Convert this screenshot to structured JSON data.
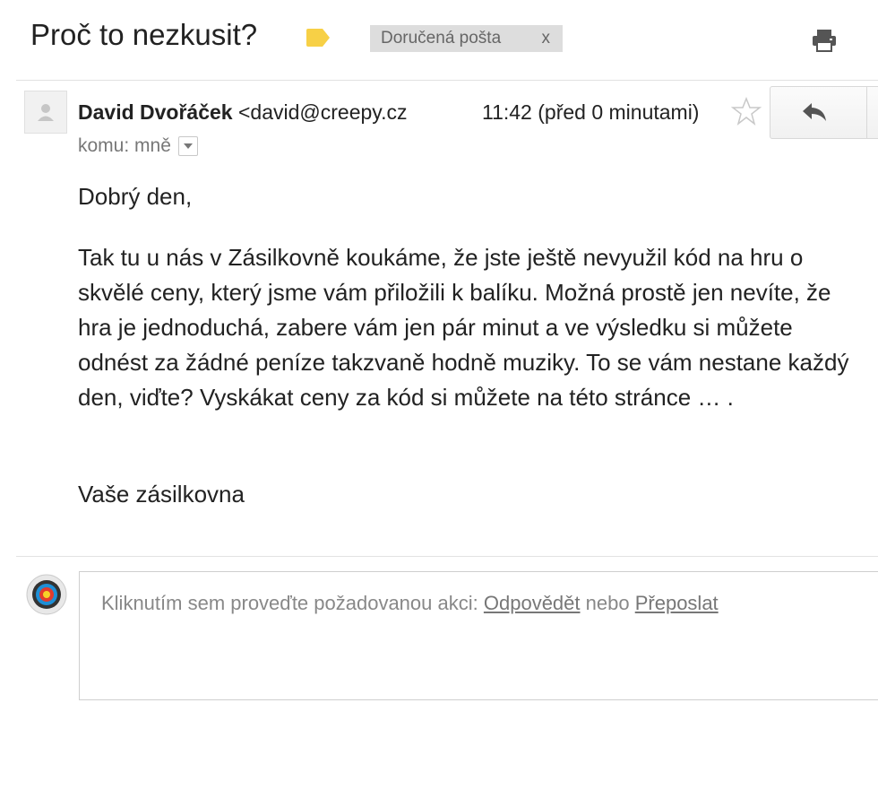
{
  "header": {
    "subject": "Proč to nezkusit?",
    "label_color": "#f7d046",
    "inbox_label": "Doručená pošta",
    "inbox_remove": "x",
    "print_icon": "printer-icon"
  },
  "message": {
    "sender_name": "David Dvořáček",
    "sender_email": "<david@creepy.cz",
    "time": "11:42 (před 0 minutami)",
    "recipient": "komu: mně",
    "star_icon": "star-outline-icon",
    "reply_icon": "reply-arrow-icon"
  },
  "body": {
    "greeting": "Dobrý den,",
    "paragraph": "Tak tu u nás v Zásilkovně koukáme, že jste ještě nevyužil kód na hru o skvělé ceny, který jsme vám přiložili k balíku. Možná prostě jen nevíte, že hra je jednoduchá, zabere vám jen pár minut a ve výsledku si můžete odnést za žádné peníze takzvaně hodně muziky. To se vám nestane každý den, viďte? Vyskákat ceny za kód si můžete na této stránce … .",
    "signature": "Vaše zásilkovna"
  },
  "reply": {
    "prompt": "Kliknutím sem proveďte požadovanou akci:",
    "reply_link": "Odpovědět",
    "or": "nebo",
    "forward_link": "Přeposlat"
  }
}
